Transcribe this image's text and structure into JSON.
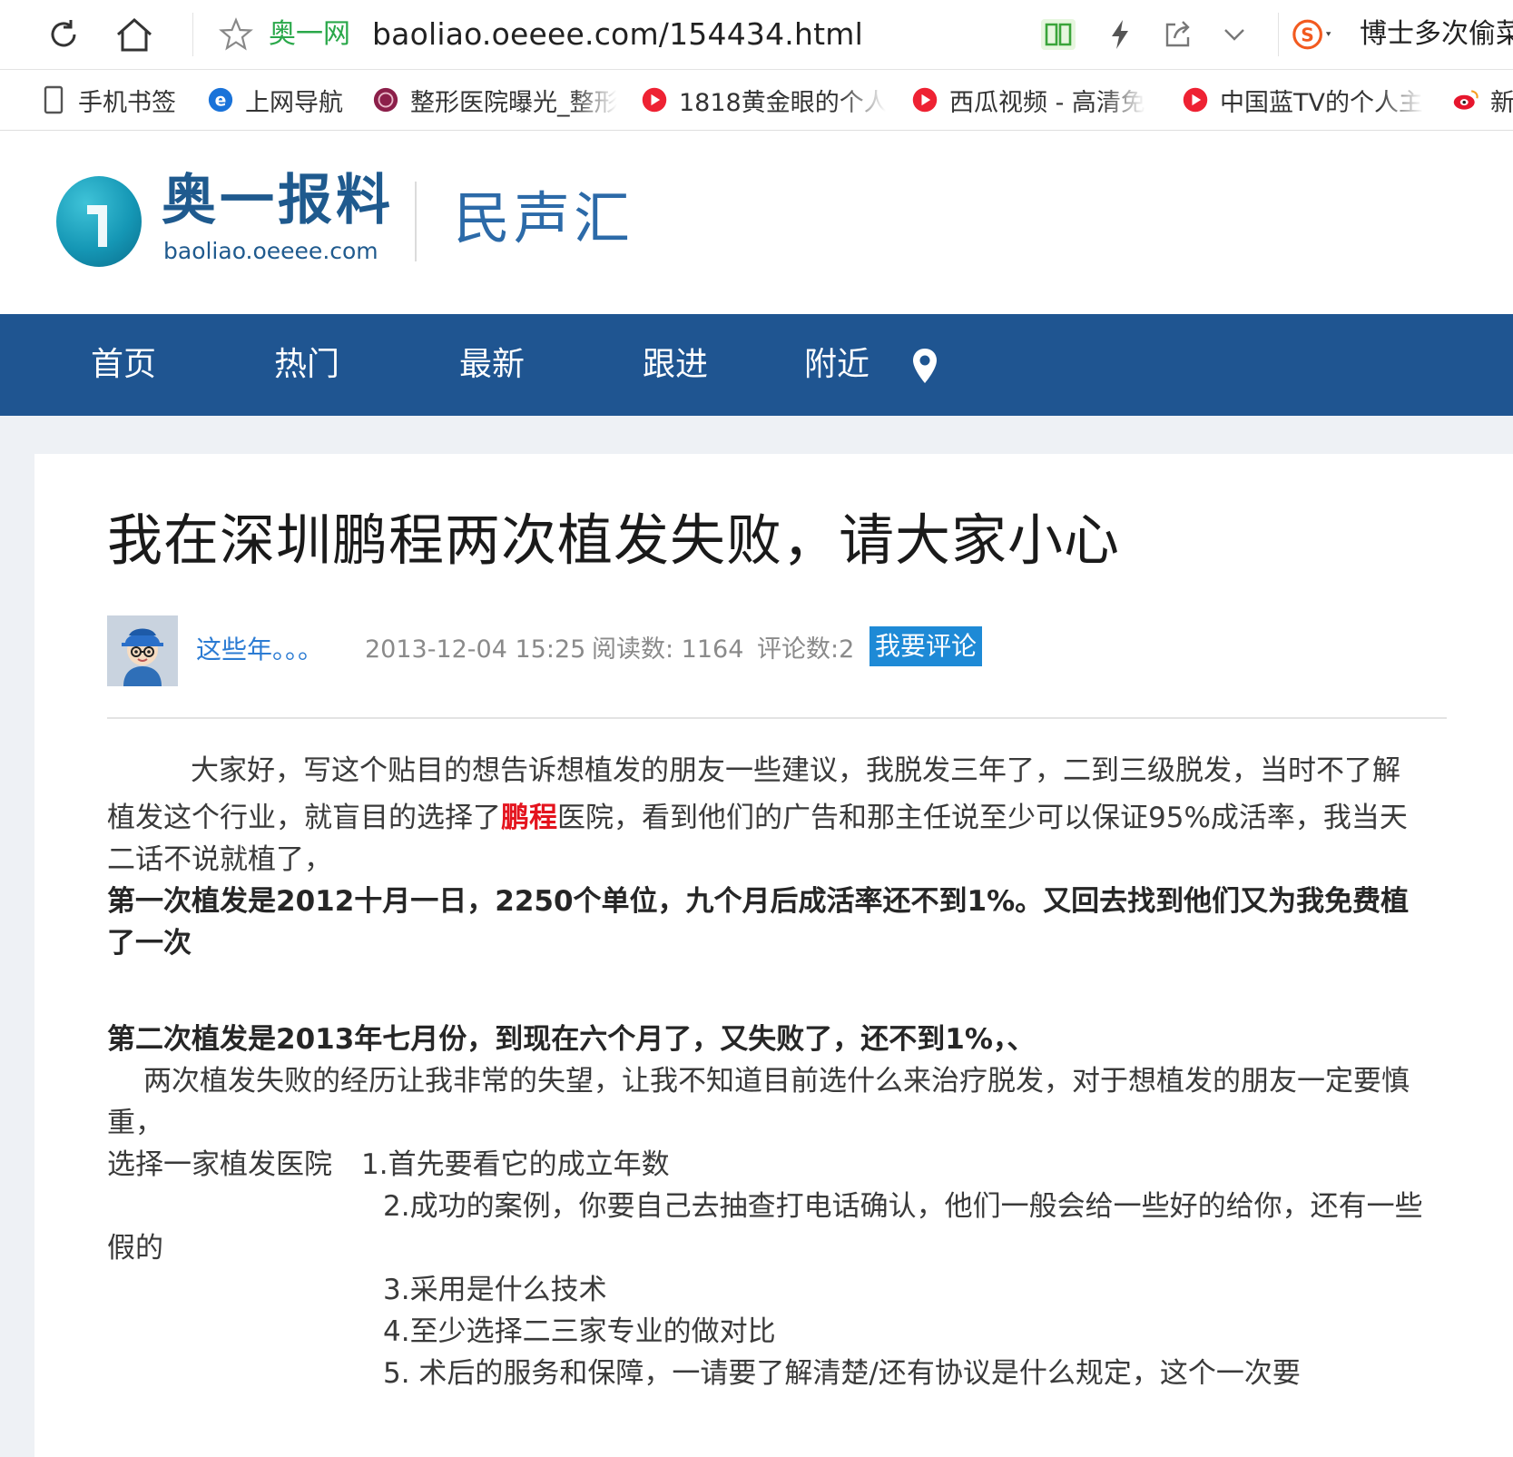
{
  "browser": {
    "site_name": "奥一网",
    "url": "baoliao.oeeee.com/154434.html",
    "right_text": "博士多次偷菜",
    "bookmarks": [
      {
        "label": "手机书签"
      },
      {
        "label": "上网导航"
      },
      {
        "label": "整形医院曝光_整形"
      },
      {
        "label": "1818黄金眼的个人"
      },
      {
        "label": "西瓜视频 - 高清免"
      },
      {
        "label": "中国蓝TV的个人主"
      },
      {
        "label": "新"
      }
    ]
  },
  "site": {
    "logo_title": "奥一报料",
    "logo_sub": "baoliao.oeeee.com",
    "section": "民声汇"
  },
  "nav": {
    "items": [
      "首页",
      "热门",
      "最新",
      "跟进",
      "附近"
    ]
  },
  "article": {
    "title": "我在深圳鹏程两次植发失败，请大家小心",
    "author": "这些年。。。",
    "date": "2013-12-04 15:25",
    "reads": "阅读数: 1164",
    "comments": "评论数:2",
    "comment_button": "我要评论",
    "p1_a": "大家好，写这个贴目的想告诉想植发的朋友一些建议，我脱发三年了，二到三级脱发，当时不了解",
    "p1_b_pre": "植发这个行业，就盲目的选择了",
    "p1_b_red": "鹏程",
    "p1_b_post": "医院，看到他们的广告和那主任说至少可以保证95%成活率，我当天",
    "p1_c": "二话不说就植了，",
    "b1_a": "第一次植发是2012十月一日，2250个单位，九个月后成活率还不到1%。又回去找到他们又为我免费植",
    "b1_b": "了一次",
    "b2": "第二次植发是2013年七月份，到现在六个月了，又失败了，还不到1%，、",
    "p2_a": "两次植发失败的经历让我非常的失望，让我不知道目前选什么来治疗脱发，对于想植发的朋友一定要慎",
    "p2_b": "重，",
    "list_lead": "选择一家植发医院",
    "item1": "1.首先要看它的成立年数",
    "item2_a": "2.成功的案例，你要自己去抽查打电话确认，他们一般会给一些好的给你，还有一些",
    "item2_b": "假的",
    "item3": "3.采用是什么技术",
    "item4": "4.至少选择二三家专业的做对比",
    "item5": "5. 术后的服务和保障，一请要了解清楚/还有协议是什么规定，这个一次要"
  },
  "colors": {
    "nav_bg": "#1f5591",
    "accent_blue": "#1e8ad6",
    "highlight_red": "#e4141e"
  }
}
